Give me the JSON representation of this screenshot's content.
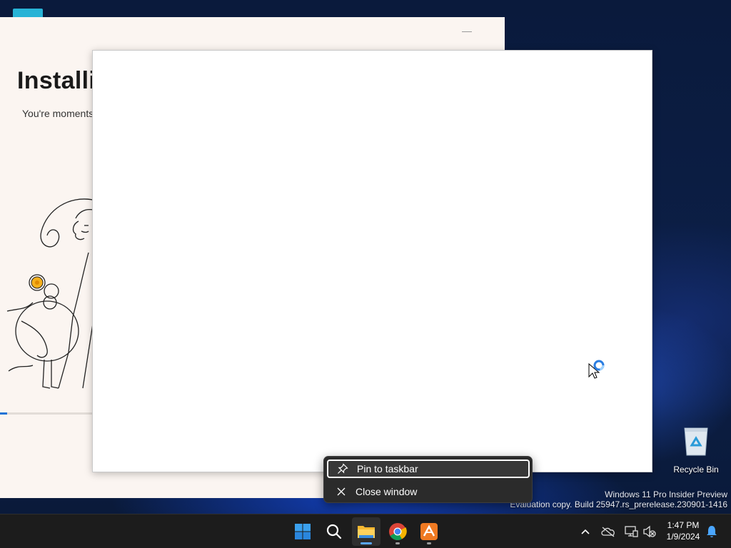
{
  "installer": {
    "title": "Installi",
    "subtitle": "You're moments",
    "progress_fraction": 0.014
  },
  "desktop": {
    "recycle_bin_label": "Recycle Bin",
    "watermark_line1": "Windows 11 Pro Insider Preview",
    "watermark_line2": "Evaluation copy. Build 25947.rs_prerelease.230901-1416"
  },
  "context_menu": {
    "items": [
      {
        "label": "Pin to taskbar",
        "icon": "pin-icon"
      },
      {
        "label": "Close window",
        "icon": "close-icon"
      }
    ]
  },
  "taskbar": {
    "apps": [
      {
        "name": "Start",
        "icon": "windows-start-icon"
      },
      {
        "name": "Search",
        "icon": "search-icon"
      },
      {
        "name": "File Explorer",
        "icon": "folder-icon"
      },
      {
        "name": "Google Chrome",
        "icon": "chrome-icon"
      },
      {
        "name": "Installer App",
        "icon": "app-icon"
      }
    ],
    "tray": [
      "chevron-up-icon",
      "onedrive-offline-icon",
      "network-icon",
      "volume-muted-icon"
    ],
    "time": "1:47 PM",
    "date": "1/9/2024"
  },
  "colors": {
    "accent": "#1e73d6",
    "taskbar_bg": "#1c1c1c",
    "menu_bg": "#2b2b2b"
  }
}
